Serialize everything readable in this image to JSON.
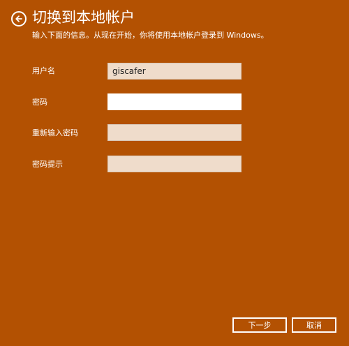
{
  "header": {
    "title": "切换到本地帐户",
    "back_icon": "arrow-left-icon"
  },
  "instructions": "输入下面的信息。从现在开始，你将使用本地帐户登录到 Windows。",
  "form": {
    "username": {
      "label": "用户名",
      "value": "giscafer"
    },
    "password": {
      "label": "密码",
      "value": ""
    },
    "confirm_password": {
      "label": "重新输入密码",
      "value": ""
    },
    "password_hint": {
      "label": "密码提示",
      "value": ""
    }
  },
  "footer": {
    "next_label": "下一步",
    "cancel_label": "取消"
  },
  "colors": {
    "background": "#b35102",
    "field_inactive": "#efdccb",
    "field_active": "#ffffff",
    "text": "#ffffff"
  }
}
